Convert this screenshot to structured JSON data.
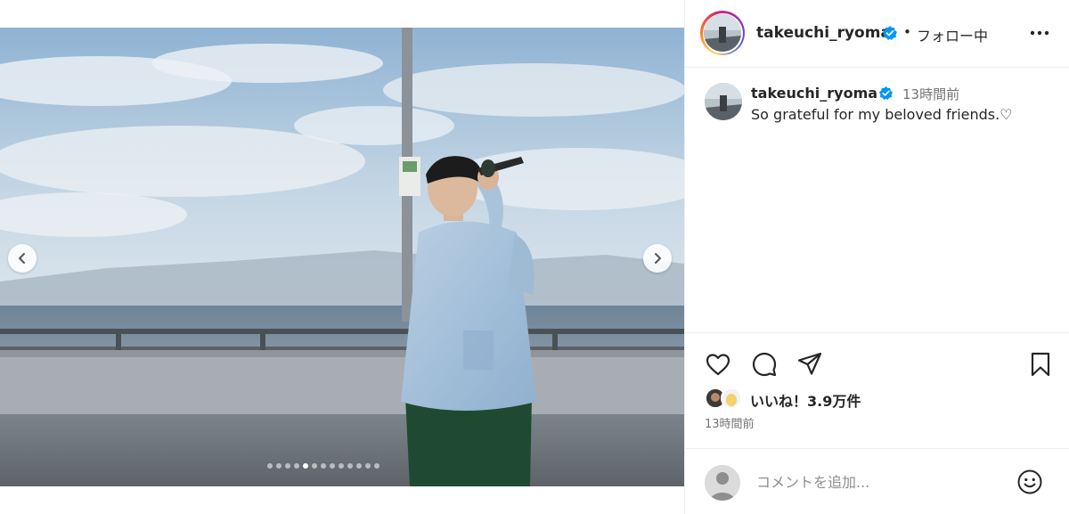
{
  "post": {
    "username": "takeuchi_ryoma",
    "verified": true,
    "separator": "•",
    "follow_status": "フォロー中",
    "more_icon": "more-horizontal-icon"
  },
  "caption": {
    "username": "takeuchi_ryoma",
    "time": "13時間前",
    "text": "So grateful for my beloved friends.♡"
  },
  "media": {
    "carousel_total": 13,
    "carousel_active_index": 4,
    "prev_icon": "chevron-left-icon",
    "next_icon": "chevron-right-icon"
  },
  "actions": {
    "like_icon": "heart-icon",
    "comment_icon": "comment-icon",
    "share_icon": "send-icon",
    "save_icon": "bookmark-icon"
  },
  "likes": {
    "text": "いいね！3.9万件"
  },
  "timestamp": "13時間前",
  "comment": {
    "placeholder": "コメントを追加...",
    "emoji_icon": "smiley-icon"
  },
  "colors": {
    "text_primary": "#262626",
    "text_secondary": "#737373",
    "verified_blue": "#0095f6",
    "divider": "#efefef"
  }
}
